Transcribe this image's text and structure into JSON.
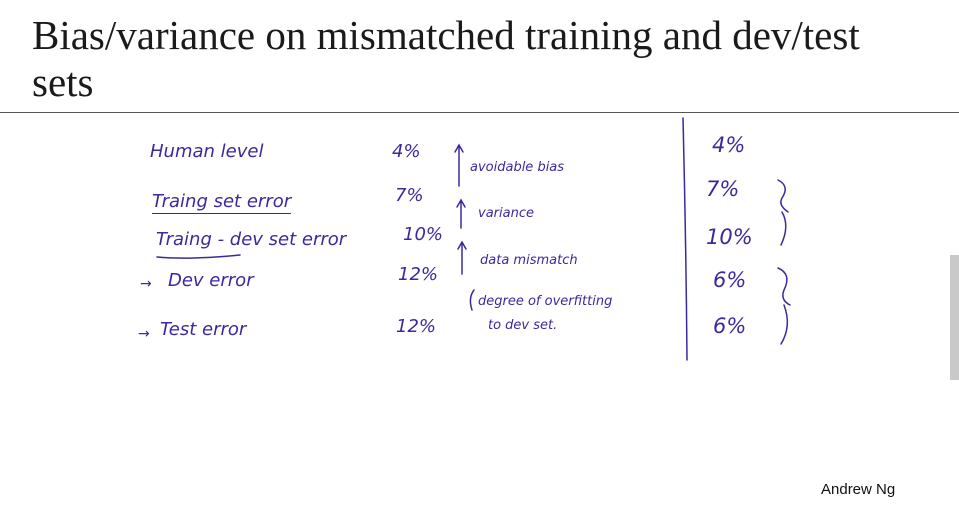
{
  "slide": {
    "title": "Bias/variance on mismatched training and dev/test sets",
    "credit": "Andrew Ng"
  },
  "rows": [
    {
      "label": "Human level",
      "value": "4%",
      "value2": "4%"
    },
    {
      "label": "Traing set error",
      "value": "7%",
      "value2": "7%"
    },
    {
      "label": "Traing - dev set error",
      "value": "10%",
      "value2": "10%"
    },
    {
      "label": "Dev error",
      "value": "12%",
      "value2": "6%"
    },
    {
      "label": "Test error",
      "value": "12%",
      "value2": "6%"
    }
  ],
  "annotations": {
    "gap1": "avoidable bias",
    "gap2": "variance",
    "gap3": "data mismatch",
    "gap4_line1": "degree of overfitting",
    "gap4_line2": "to dev set."
  },
  "markers": {
    "dev_arrow": "→",
    "test_arrow": "→"
  },
  "colors": {
    "ink": "#3a2a9e",
    "title": "#1a1a1a",
    "background": "#ffffff"
  }
}
